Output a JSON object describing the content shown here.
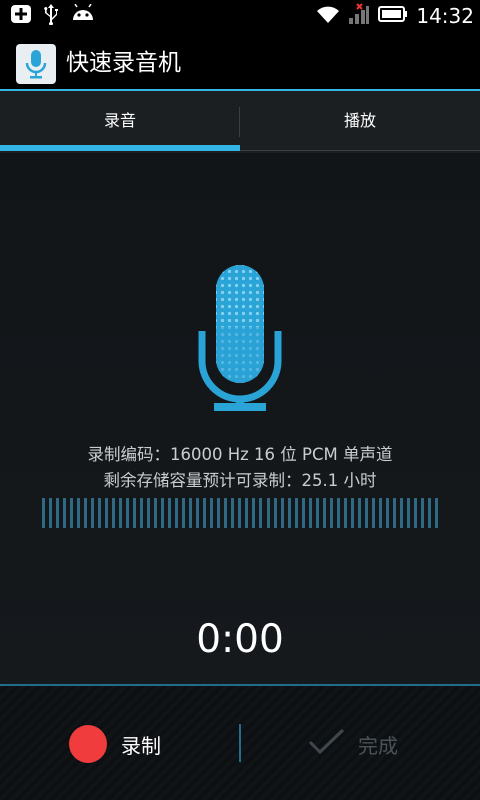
{
  "status_bar": {
    "time": "14:32",
    "left_icons": [
      "add-icon",
      "usb-icon",
      "android-icon"
    ],
    "right_icons": [
      "wifi-icon",
      "no-signal-icon",
      "battery-icon"
    ]
  },
  "app": {
    "title": "快速录音机",
    "icon": "microphone-icon",
    "accent_color": "#33b5e5"
  },
  "tabs": [
    {
      "label": "录音",
      "selected": true
    },
    {
      "label": "播放",
      "selected": false
    }
  ],
  "recorder": {
    "encoding_info": "录制编码：16000 Hz 16 位 PCM 单声道",
    "remaining_info": "剩余存储容量预计可录制：25.1 小时",
    "elapsed_time": "0:00",
    "level_meter_level": 0
  },
  "actions": {
    "record_label": "录制",
    "done_label": "完成",
    "record_color": "#f03c3c"
  }
}
